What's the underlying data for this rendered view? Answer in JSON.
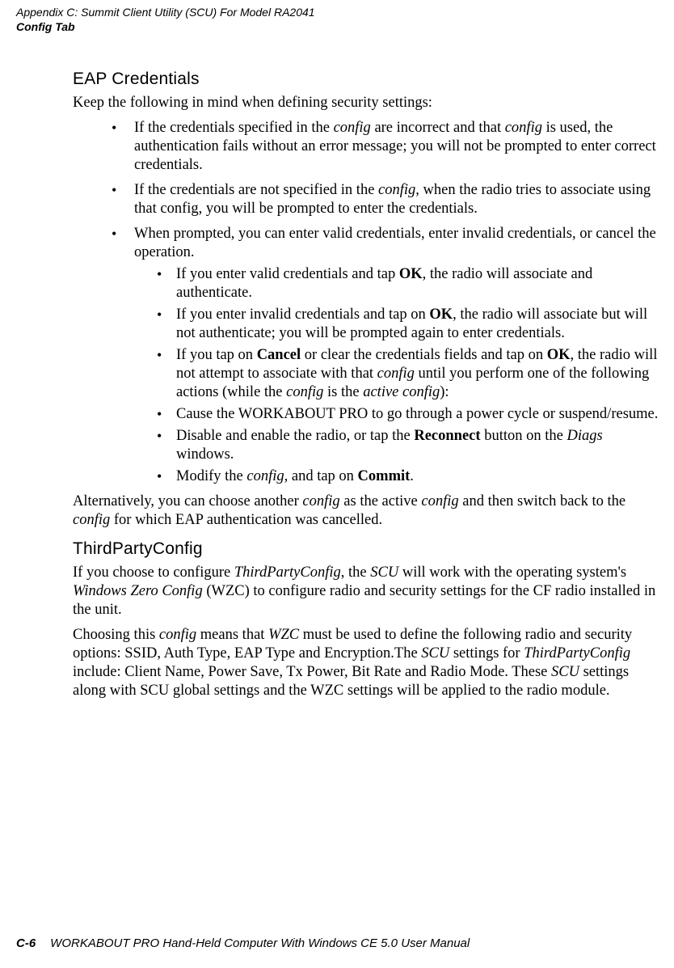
{
  "header": {
    "line1": "Appendix  C:  Summit Client Utility (SCU) For Model RA2041",
    "line2": "Config Tab"
  },
  "sections": {
    "eap": {
      "title": "EAP  Credentials",
      "intro": "Keep the following in mind when defining security settings:",
      "b1_pre": "If the credentials specified in the ",
      "b1_cfg1": "config",
      "b1_mid": " are incorrect and that ",
      "b1_cfg2": "config",
      "b1_post": " is used, the authentication fails without an error message; you will not be prompted to enter correct credentials.",
      "b2_pre": "If the credentials are not specified in the ",
      "b2_cfg": "config",
      "b2_post": ", when the radio tries to asso­ciate using that config, you will be prompted to enter the credentials.",
      "b3": "When prompted, you can enter valid credentials, enter invalid credentials, or cancel the operation.",
      "b3a_pre": "If you enter valid credentials and tap ",
      "b3a_ok": "OK",
      "b3a_post": ", the radio will associate and authenticate.",
      "b3b_pre": "If you enter invalid credentials and tap on ",
      "b3b_ok": "OK",
      "b3b_post": ", the radio will associate but will not authenticate; you will be prompted again to enter creden­tials.",
      "b3c_pre": "If you tap on ",
      "b3c_cancel": "Cancel",
      "b3c_mid1": " or clear the credentials fields and tap on ",
      "b3c_ok": "OK",
      "b3c_mid2": ", the radio will not attempt to associate with that ",
      "b3c_cfg1": "config",
      "b3c_mid3": " until you perform one of the following actions (while the ",
      "b3c_cfg2": "config",
      "b3c_mid4": " is the ",
      "b3c_active": "active config",
      "b3c_post": "):",
      "b3d": "Cause the WORKABOUT PRO to go through a power cycle or sus­pend/resume.",
      "b3e_pre": "Disable and enable the radio, or tap the ",
      "b3e_rec": "Reconnect",
      "b3e_mid": " button on the ",
      "b3e_diags": "Diags",
      "b3e_post": " windows.",
      "b3f_pre": "Modify the ",
      "b3f_cfg": "config,",
      "b3f_mid": " and tap on ",
      "b3f_commit": "Commit",
      "b3f_post": ".",
      "alt_pre": "Alternatively, you can choose another ",
      "alt_cfg1": "config",
      "alt_mid": " as the active ",
      "alt_cfg2": "config",
      "alt_mid2": " and then switch back to the ",
      "alt_cfg3": "config",
      "alt_post": " for which EAP authentication was cancelled."
    },
    "tpc": {
      "title": "ThirdPartyConfig",
      "p1_pre": "If you choose to configure ",
      "p1_tpc": "ThirdPartyConfig",
      "p1_mid1": ", the ",
      "p1_scu": "SCU",
      "p1_mid2": " will work with the operating system's ",
      "p1_wzc": "Windows Zero Config",
      "p1_post": " (WZC) to configure radio and security settings for the CF radio installed in the unit.",
      "p2_pre": "Choosing this ",
      "p2_cfg": "config",
      "p2_mid1": " means that ",
      "p2_wzc": "WZC",
      "p2_mid2": " must be used to define the following radio and security options: SSID, Auth Type, EAP Type and Encryption.The ",
      "p2_scu1": "SCU",
      "p2_mid3": " settings for ",
      "p2_tpc": "ThirdPartyConfig",
      "p2_mid4": " include: Client Name, Power Save, Tx Power, Bit Rate and Radio Mode. These ",
      "p2_scu2": "SCU",
      "p2_post": " settings along with SCU global settings and the WZC settings will be applied to the radio module."
    }
  },
  "footer": {
    "pagenum": "C-6",
    "title": "WORKABOUT PRO Hand-Held Computer With Windows CE 5.0 User Manual"
  }
}
